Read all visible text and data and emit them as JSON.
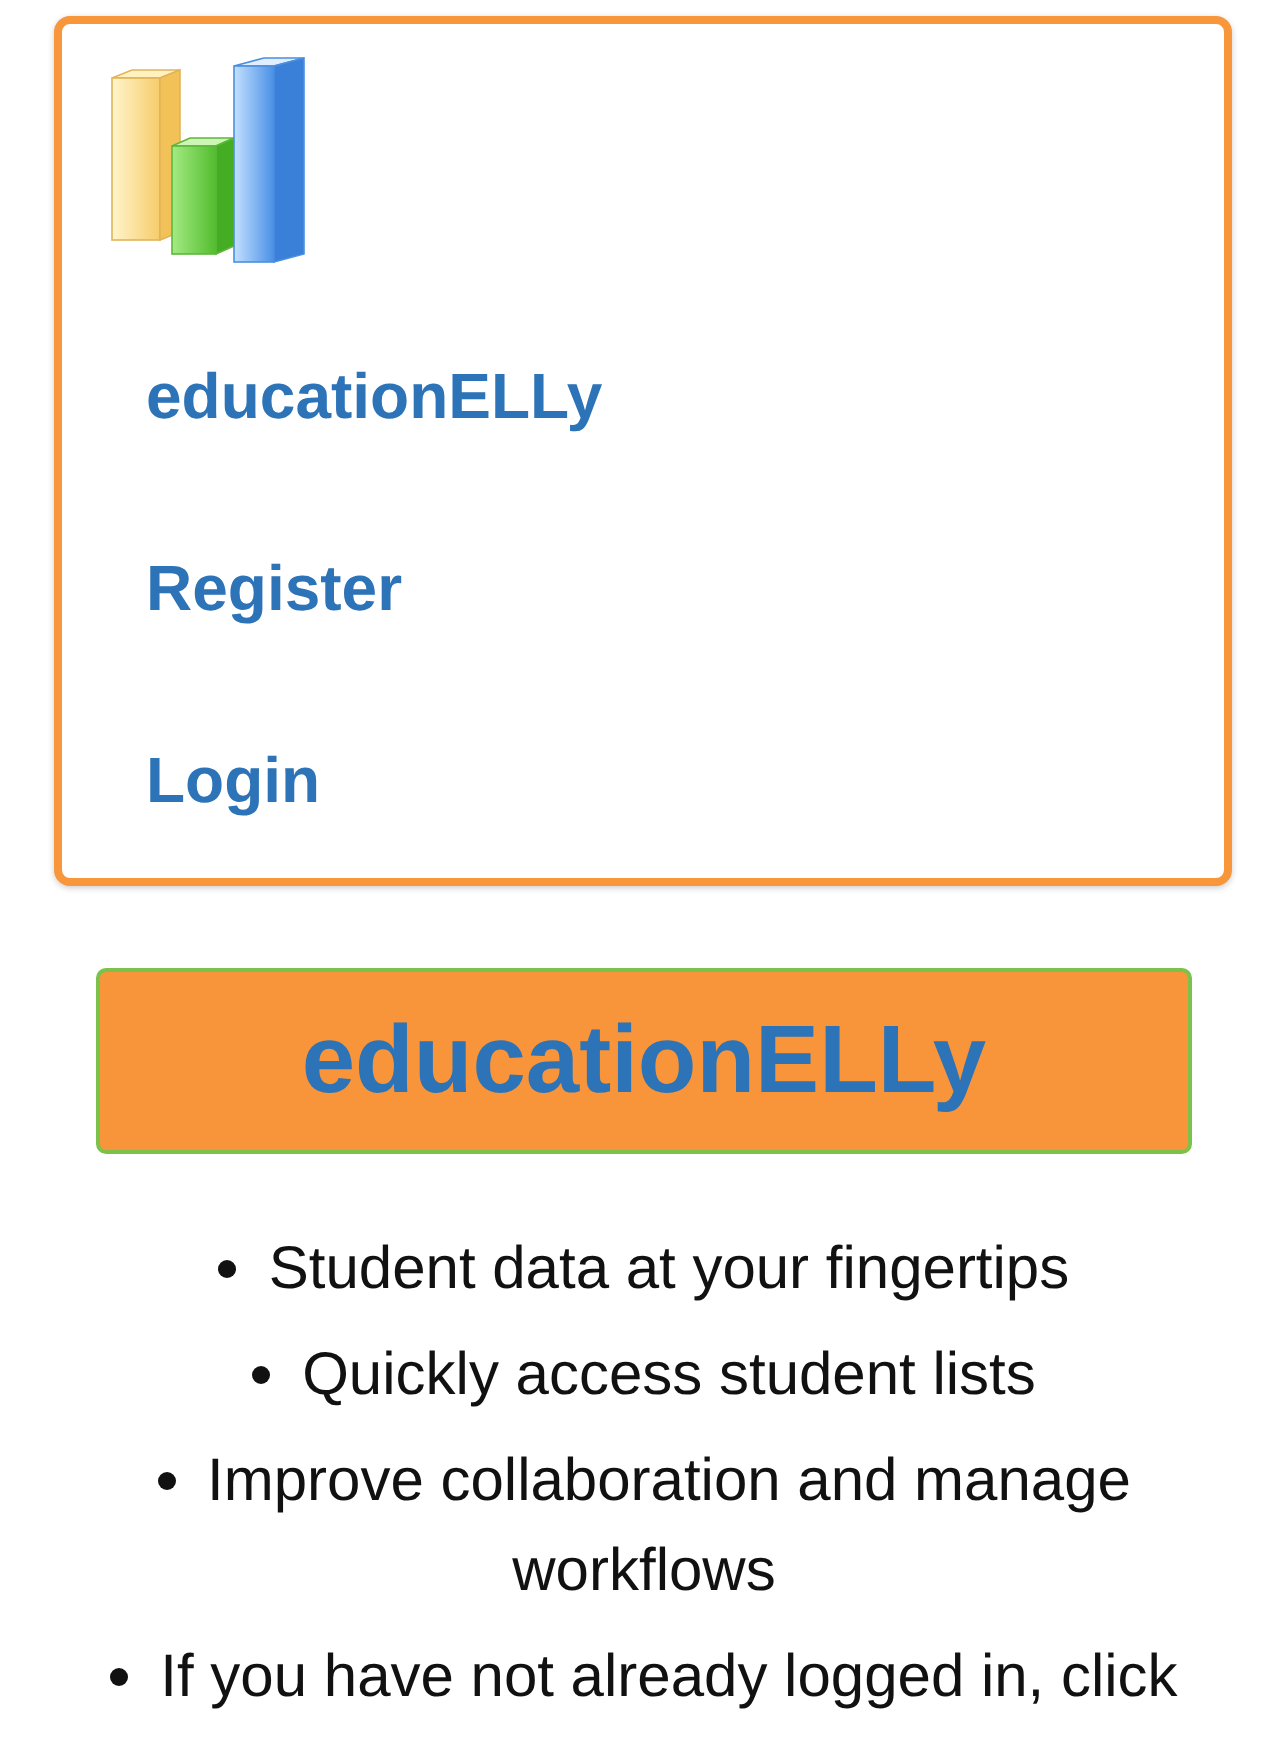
{
  "nav": {
    "links": [
      {
        "label": "educationELLy"
      },
      {
        "label": "Register"
      },
      {
        "label": "Login"
      }
    ]
  },
  "banner": {
    "title": "educationELLy"
  },
  "features": [
    "Student data at your fingertips",
    "Quickly access student lists",
    "Improve collaboration and manage workflows",
    "If you have not already logged in, click"
  ]
}
